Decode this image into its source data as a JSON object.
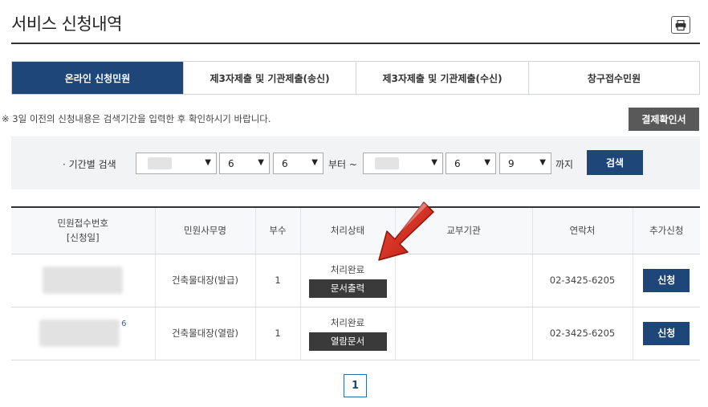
{
  "header": {
    "title": "서비스 신청내역",
    "print_icon": "printer-icon"
  },
  "tabs": [
    {
      "label": "온라인 신청민원",
      "active": true
    },
    {
      "label": "제3자제출 및 기관제출(송신)",
      "active": false
    },
    {
      "label": "제3자제출 및 기관제출(수신)",
      "active": false
    },
    {
      "label": "창구접수민원",
      "active": false
    }
  ],
  "notice": "※ 3일 이전의 신청내용은 검색기간을 입력한 후 확인하시기 바랍니다.",
  "receipt_button": "결제확인서",
  "search": {
    "label": "· 기간별 검색",
    "from_month": "6",
    "from_day": "6",
    "from_suffix": "부터 ~",
    "to_month": "6",
    "to_day": "9",
    "to_suffix": "까지",
    "button": "검색"
  },
  "table": {
    "headers": [
      "민원접수번호\n[신청일]",
      "민원사무명",
      "부수",
      "처리상태",
      "교부기관",
      "연락처",
      "추가신청"
    ],
    "rows": [
      {
        "id_suffix": "",
        "name": "건축물대장(발급)",
        "copies": "1",
        "status": "처리완료",
        "action": "문서출력",
        "agency": "",
        "phone": "02-3425-6205",
        "apply": "신청"
      },
      {
        "id_suffix": "6",
        "name": "건축물대장(열람)",
        "copies": "1",
        "status": "처리완료",
        "action": "열람문서",
        "agency": "",
        "phone": "02-3425-6205",
        "apply": "신청"
      }
    ]
  },
  "pagination": {
    "current": "1"
  },
  "colors": {
    "primary": "#1f4679",
    "dark_button": "#3a3a3a",
    "arrow": "#d42a1e"
  }
}
